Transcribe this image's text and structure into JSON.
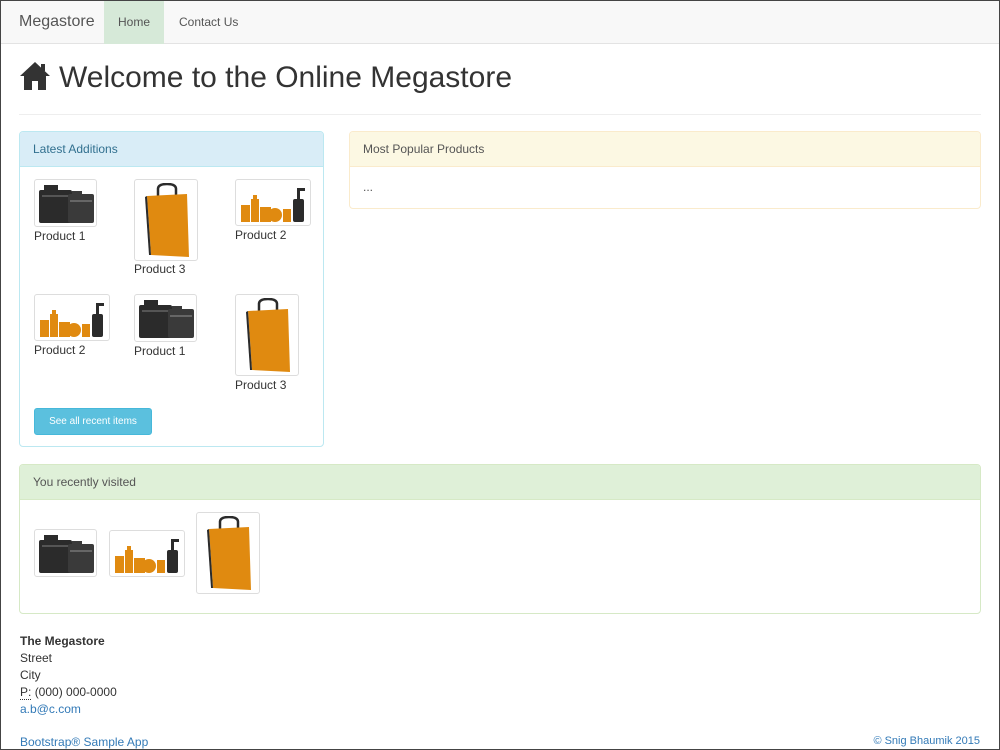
{
  "navbar": {
    "brand": "Megastore",
    "items": [
      {
        "label": "Home",
        "active": true
      },
      {
        "label": "Contact Us",
        "active": false
      }
    ]
  },
  "header": {
    "title": "Welcome to the Online Megastore",
    "icon": "home-icon"
  },
  "latest": {
    "title": "Latest Additions",
    "products": [
      {
        "label": "Product 1",
        "icon": "cameras-icon"
      },
      {
        "label": "Product 3",
        "icon": "shopping-bag-icon"
      },
      {
        "label": "Product 2",
        "icon": "bottles-icon"
      },
      {
        "label": "Product 2",
        "icon": "bottles-icon"
      },
      {
        "label": "Product 1",
        "icon": "cameras-icon"
      },
      {
        "label": "Product 3",
        "icon": "shopping-bag-icon"
      }
    ],
    "button_label": "See all recent items"
  },
  "popular": {
    "title": "Most Popular Products",
    "body": "..."
  },
  "recent": {
    "title": "You recently visited",
    "items": [
      {
        "icon": "cameras-icon"
      },
      {
        "icon": "bottles-icon"
      },
      {
        "icon": "shopping-bag-icon"
      }
    ]
  },
  "address": {
    "name": "The Megastore",
    "street": "Street",
    "city": "City",
    "phone_prefix": "P:",
    "phone": "(000) 000-0000",
    "email": "a.b@c.com"
  },
  "footer": {
    "left": "Bootstrap® Sample App",
    "right": "© Snig Bhaumik 2015"
  },
  "colors": {
    "icon_orange": "#e08a10",
    "icon_dark": "#2b2b2b",
    "info_heading": "#d9edf7",
    "warning_heading": "#fcf8e3",
    "success_heading": "#dff0d8",
    "button": "#5bc0de",
    "link": "#337ab7"
  }
}
